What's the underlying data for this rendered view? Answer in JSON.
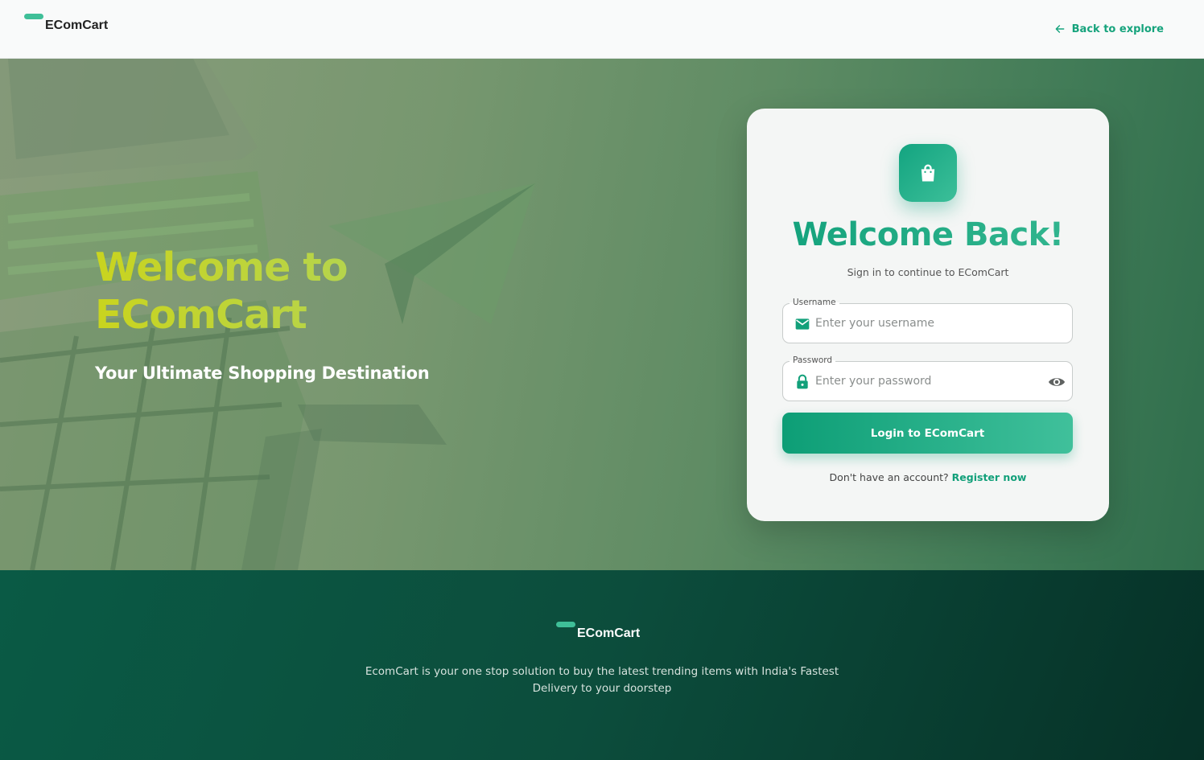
{
  "header": {
    "brand": "EComCart",
    "back_link": "Back to explore"
  },
  "hero": {
    "title_line1": "Welcome to",
    "title_line2": "EComCart",
    "subtitle": "Your Ultimate Shopping Destination"
  },
  "login": {
    "title": "Welcome Back!",
    "subtitle": "Sign in to continue to EComCart",
    "username_label": "Username",
    "username_placeholder": "Enter your username",
    "password_label": "Password",
    "password_placeholder": "Enter your password",
    "submit_label": "Login to EComCart",
    "register_prompt": "Don't have an account?",
    "register_link": "Register now"
  },
  "footer": {
    "brand": "EComCart",
    "description": "EcomCart is your one stop solution to buy the latest trending items with India's Fastest Delivery to your doorstep"
  },
  "icons": {
    "back": "arrow-left-icon",
    "bag": "shopping-bag-icon",
    "username": "mail-icon",
    "password": "lock-icon",
    "toggle": "eye-icon"
  },
  "colors": {
    "accent": "#16a37c",
    "accent_light": "#3fbf98",
    "hero_title": "#c9d41f",
    "footer_bg": "#0a5a45"
  }
}
